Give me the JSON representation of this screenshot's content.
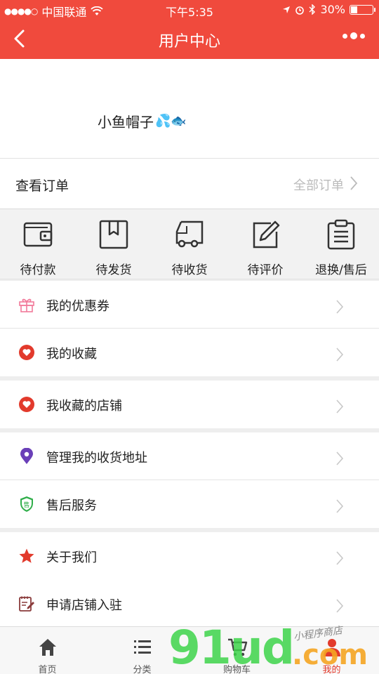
{
  "status_bar": {
    "signal_dots": "●●●●○",
    "carrier": "中国联通",
    "wifi_icon": "wifi-icon",
    "time": "下午5:35",
    "battery_percent": "30%",
    "battery_level": 0.3
  },
  "nav": {
    "title": "用户中心"
  },
  "profile": {
    "username": "小鱼帽子",
    "emoji": "💦🐟"
  },
  "orders": {
    "label": "查看订单",
    "all_label": "全部订单",
    "statuses": [
      {
        "label": "待付款",
        "icon": "wallet-icon"
      },
      {
        "label": "待发货",
        "icon": "package-icon"
      },
      {
        "label": "待收货",
        "icon": "truck-icon"
      },
      {
        "label": "待评价",
        "icon": "edit-review-icon"
      },
      {
        "label": "退换/售后",
        "icon": "clipboard-icon"
      }
    ]
  },
  "menu": {
    "coupons": {
      "label": "我的优惠券",
      "icon": "gift-icon",
      "color": "#f27a9a"
    },
    "favorites": {
      "label": "我的收藏",
      "icon": "heart-icon",
      "color": "#e23a2c"
    },
    "fav_stores": {
      "label": "我收藏的店铺",
      "icon": "heart-icon",
      "color": "#e23a2c"
    },
    "addresses": {
      "label": "管理我的收货地址",
      "icon": "location-pin-icon",
      "color": "#6a3fb8"
    },
    "after_sales": {
      "label": "售后服务",
      "icon": "shield-icon",
      "color": "#2fae4a",
      "badge": "售"
    },
    "about": {
      "label": "关于我们",
      "icon": "star-icon",
      "color": "#e23a2c"
    },
    "apply_store": {
      "label": "申请店铺入驻",
      "icon": "notepad-icon",
      "color": "#8a3b3b"
    }
  },
  "tabbar": {
    "tabs": [
      {
        "label": "首页",
        "icon": "home-icon"
      },
      {
        "label": "分类",
        "icon": "list-icon"
      },
      {
        "label": "购物车",
        "icon": "cart-icon"
      },
      {
        "label": "我的",
        "icon": "user-icon"
      }
    ],
    "active_index": 3
  },
  "watermark": {
    "main": "91ud",
    "domain": ".com",
    "tagline": "小程序商店"
  },
  "colors": {
    "brand_red": "#f04a3d",
    "muted_text": "#bbbbbb"
  }
}
